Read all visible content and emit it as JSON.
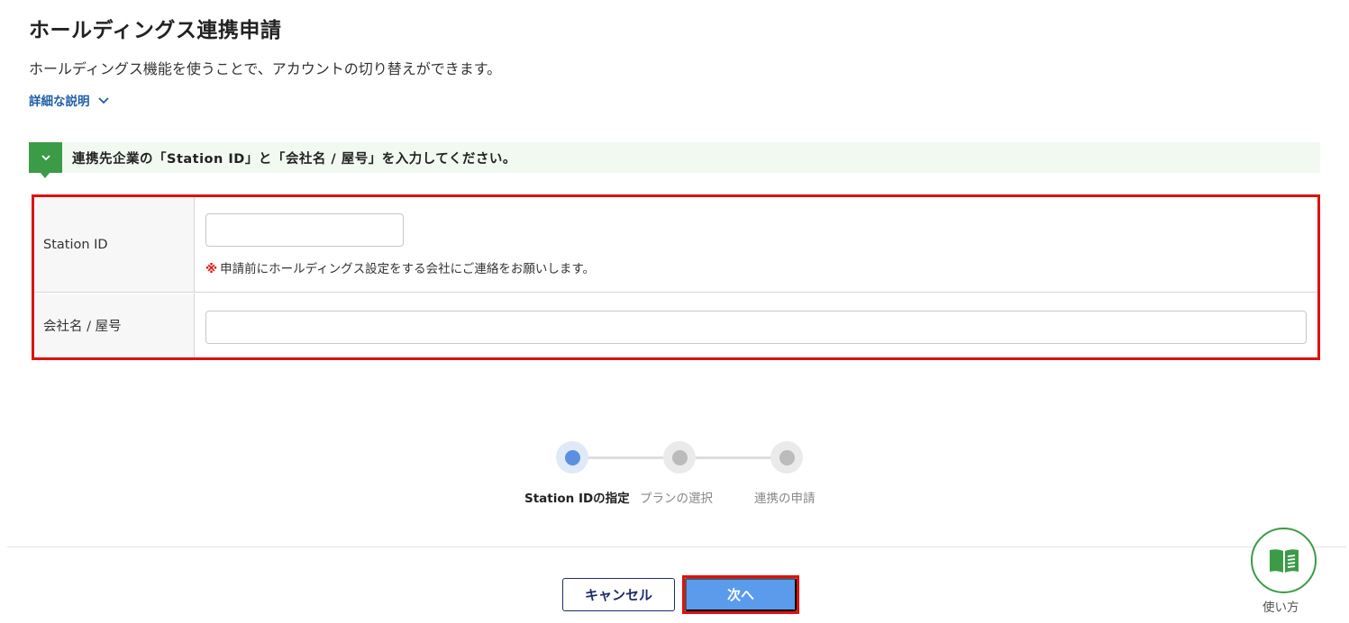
{
  "header": {
    "title": "ホールディングス連携申請",
    "description": "ホールディングス機能を使うことで、アカウントの切り替えができます。",
    "detail_link": "詳細な説明"
  },
  "instruction": {
    "text": "連携先企業の「Station ID」と「会社名 / 屋号」を入力してください。"
  },
  "form": {
    "station_id_label": "Station ID",
    "station_id_value": "",
    "station_id_note_mark": "※",
    "station_id_note": "申請前にホールディングス設定をする会社にご連絡をお願いします。",
    "company_label": "会社名 / 屋号",
    "company_value": ""
  },
  "stepper": {
    "steps": [
      {
        "label": "Station IDの指定",
        "state": "active"
      },
      {
        "label": "プランの選択",
        "state": "inactive"
      },
      {
        "label": "連携の申請",
        "state": "inactive"
      }
    ]
  },
  "actions": {
    "cancel_label": "キャンセル",
    "next_label": "次へ"
  },
  "help": {
    "label": "使い方"
  },
  "colors": {
    "accent_green": "#3c9b47",
    "link_blue": "#1f5fa9",
    "primary_button": "#5b9bec",
    "highlight_red": "#e01010",
    "active_step": "#5a90df"
  },
  "icons": {
    "detail": "chevron-down-icon",
    "instruction_badge": "chevron-down-icon",
    "help": "book-icon"
  }
}
